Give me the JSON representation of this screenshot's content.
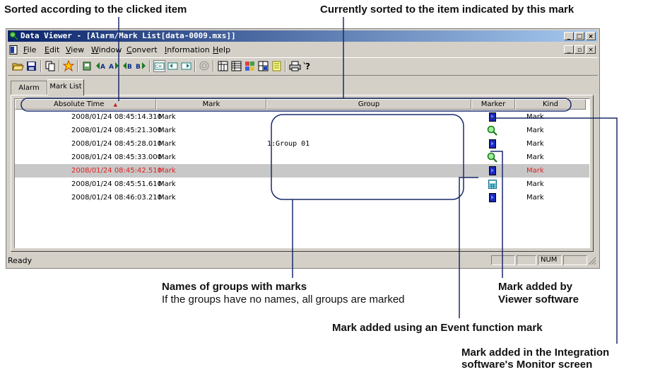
{
  "annotations": {
    "sorted_clicked": "Sorted according to the clicked item",
    "currently_sorted": "Currently sorted to the item indicated by this mark",
    "group_names_title": "Names of groups with marks",
    "group_names_sub": "If the groups have no names, all groups are marked",
    "mark_viewer_1": "Mark added by",
    "mark_viewer_2": "Viewer software",
    "mark_event": "Mark added using an Event function mark",
    "mark_integration_1": "Mark added in the Integration",
    "mark_integration_2": "software's Monitor screen"
  },
  "window": {
    "title": "Data Viewer - [Alarm/Mark List[data-0009.mxs]]",
    "min_label": "_",
    "max_label": "□",
    "close_label": "×",
    "child_min_label": "_",
    "child_restore_label": "▫",
    "child_close_label": "×"
  },
  "menu": [
    {
      "label": "File",
      "accel": "F"
    },
    {
      "label": "Edit",
      "accel": "E"
    },
    {
      "label": "View",
      "accel": "V"
    },
    {
      "label": "Window",
      "accel": "W"
    },
    {
      "label": "Convert",
      "accel": "C"
    },
    {
      "label": "Information",
      "accel": "I"
    },
    {
      "label": "Help",
      "accel": "H"
    }
  ],
  "toolbar": {
    "items": [
      "open-icon",
      "save-icon",
      "copy-icon",
      "star-icon",
      "marker-icon",
      "jump-a-left-icon",
      "jump-a-right-icon",
      "jump-b-left-icon",
      "jump-b-right-icon",
      "ch-icon",
      "scroll-left-icon",
      "scroll-right-icon",
      "zoom-icon",
      "grid1-icon",
      "grid2-icon",
      "grid3-icon",
      "grid4-icon",
      "list-icon",
      "print-icon",
      "help-icon"
    ]
  },
  "tabs": [
    {
      "label": "Alarm List",
      "active": false
    },
    {
      "label": "Mark List",
      "active": true
    }
  ],
  "columns": {
    "absolute_time": "Absolute Time",
    "sort_indicator": "▲",
    "mark": "Mark",
    "group": "Group",
    "marker": "Marker",
    "kind": "Kind"
  },
  "rows": [
    {
      "time": "2008/01/24 08:45:14.310",
      "mark": "Mark",
      "group": "",
      "marker_icon": "blue-flag-icon",
      "kind": "Mark",
      "selected": false
    },
    {
      "time": "2008/01/24 08:45:21.300",
      "mark": "Mark",
      "group": "",
      "marker_icon": "magnifier-icon",
      "kind": "Mark",
      "selected": false
    },
    {
      "time": "2008/01/24 08:45:28.010",
      "mark": "Mark",
      "group": "1:Group 01",
      "marker_icon": "blue-flag-icon",
      "kind": "Mark",
      "selected": false
    },
    {
      "time": "2008/01/24 08:45:33.000",
      "mark": "Mark",
      "group": "",
      "marker_icon": "magnifier-icon",
      "kind": "Mark",
      "selected": false
    },
    {
      "time": "2008/01/24 08:45:42.510",
      "mark": "Mark",
      "group": "",
      "marker_icon": "blue-flag-icon",
      "kind": "Mark",
      "selected": true
    },
    {
      "time": "2008/01/24 08:45:51.610",
      "mark": "Mark",
      "group": "",
      "marker_icon": "calculator-icon",
      "kind": "Mark",
      "selected": false
    },
    {
      "time": "2008/01/24 08:46:03.210",
      "mark": "Mark",
      "group": "",
      "marker_icon": "blue-flag-icon",
      "kind": "Mark",
      "selected": false
    }
  ],
  "status": {
    "text": "Ready",
    "num": "NUM"
  },
  "colors": {
    "title_start": "#0a246a",
    "title_end": "#a6caf0",
    "selected_text": "#e02020",
    "selected_row": "#c8c8c8",
    "callout_line": "#1a2a6a"
  }
}
